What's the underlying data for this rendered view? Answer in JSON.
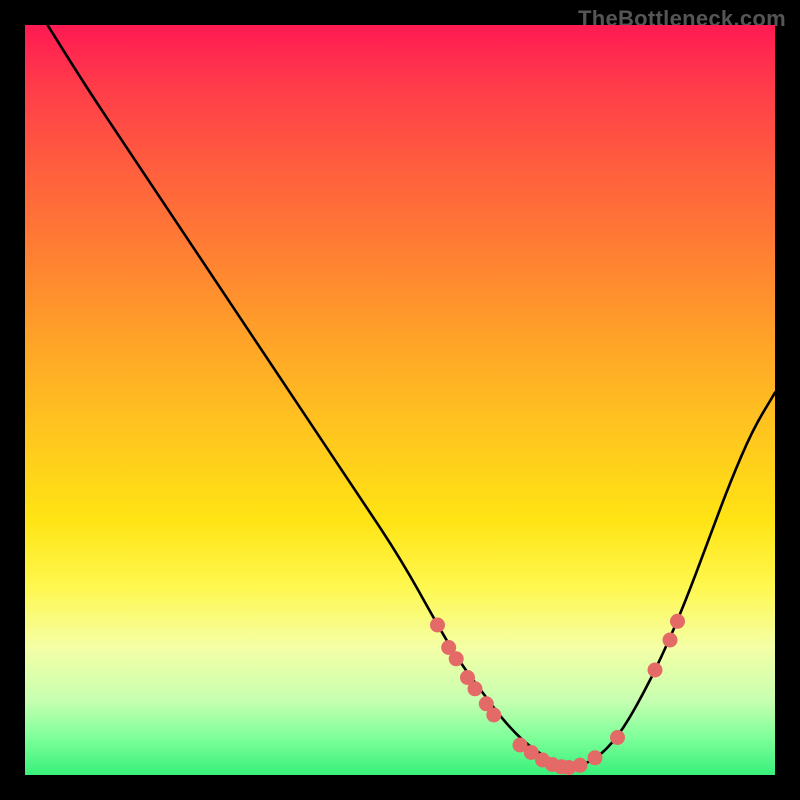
{
  "watermark": "TheBottleneck.com",
  "colors": {
    "background": "#000000",
    "curve": "#000000",
    "points": "#e46a67",
    "watermark": "#555555"
  },
  "chart_data": {
    "type": "line",
    "title": "",
    "xlabel": "",
    "ylabel": "",
    "xlim": [
      0,
      100
    ],
    "ylim": [
      0,
      100
    ],
    "grid": false,
    "series": [
      {
        "name": "bottleneck-curve",
        "x": [
          3,
          8,
          14,
          20,
          26,
          32,
          38,
          44,
          50,
          55,
          58,
          61,
          64,
          67,
          70,
          73,
          76,
          79,
          82,
          85,
          88,
          91,
          94,
          97,
          100
        ],
        "values": [
          100,
          92,
          83,
          74,
          65,
          56,
          47,
          38,
          29,
          20,
          15,
          11,
          7,
          4,
          2,
          1,
          2,
          5,
          10,
          16,
          23,
          31,
          39,
          46,
          51
        ]
      }
    ],
    "points": [
      {
        "x": 55,
        "y": 20
      },
      {
        "x": 56.5,
        "y": 17
      },
      {
        "x": 57.5,
        "y": 15.5
      },
      {
        "x": 59,
        "y": 13
      },
      {
        "x": 60,
        "y": 11.5
      },
      {
        "x": 61.5,
        "y": 9.5
      },
      {
        "x": 62.5,
        "y": 8
      },
      {
        "x": 66,
        "y": 4
      },
      {
        "x": 67.5,
        "y": 3
      },
      {
        "x": 69,
        "y": 2
      },
      {
        "x": 70.3,
        "y": 1.4
      },
      {
        "x": 71.5,
        "y": 1.1
      },
      {
        "x": 72.5,
        "y": 1
      },
      {
        "x": 74,
        "y": 1.3
      },
      {
        "x": 76,
        "y": 2.3
      },
      {
        "x": 79,
        "y": 5
      },
      {
        "x": 84,
        "y": 14
      },
      {
        "x": 86,
        "y": 18
      },
      {
        "x": 87,
        "y": 20.5
      }
    ]
  }
}
